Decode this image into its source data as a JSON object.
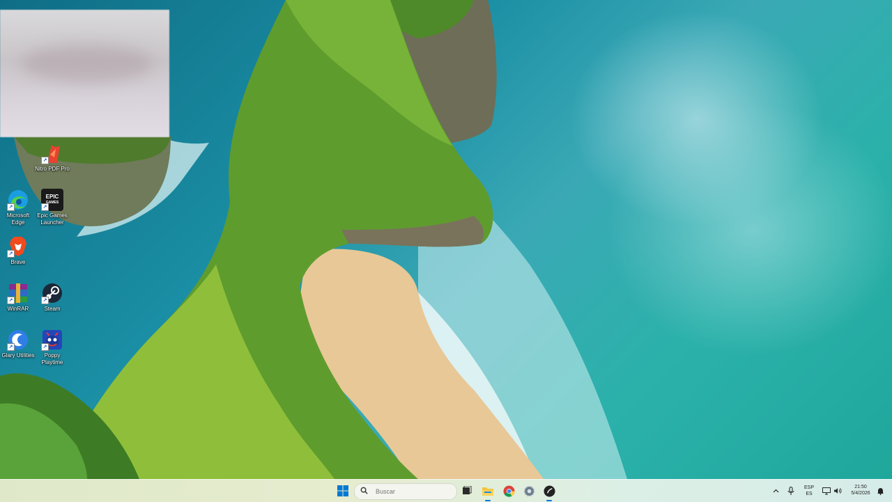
{
  "desktop": {
    "icons": [
      {
        "label": "Nitro PDF Pro",
        "icon": "nitro-pdf-icon",
        "color": "#e8432f"
      },
      {
        "label": "Microsoft Edge",
        "icon": "edge-icon",
        "color": "#1b9de2"
      },
      {
        "label": "Epic Games Launcher",
        "icon": "epic-games-icon",
        "color": "#1a1a1a",
        "glyph": "EPIC\nGAMES"
      },
      {
        "label": "Brave",
        "icon": "brave-icon",
        "color": "#f14a1d"
      },
      {
        "label": "WinRAR",
        "icon": "winrar-icon",
        "color": "#8b2a8f"
      },
      {
        "label": "Steam",
        "icon": "steam-icon",
        "color": "#1b2838"
      },
      {
        "label": "Glary Utilities",
        "icon": "glary-utilities-icon",
        "color": "#2f7ee6"
      },
      {
        "label": "Poppy Playtime",
        "icon": "poppy-playtime-icon",
        "color": "#2346b8"
      }
    ]
  },
  "taskbar": {
    "search_placeholder": "Buscar",
    "pinned": [
      "windows-start-icon",
      "task-view-icon",
      "file-explorer-icon",
      "chrome-icon",
      "settings-icon",
      "app-dark-icon"
    ],
    "tray": {
      "language_top": "ESP",
      "language_bottom": "ES",
      "time": "21:50",
      "date": "5/4/2026"
    }
  },
  "colors": {
    "taskbar_bg": "#e3ebd0",
    "windows_blue": "#0078d4"
  }
}
